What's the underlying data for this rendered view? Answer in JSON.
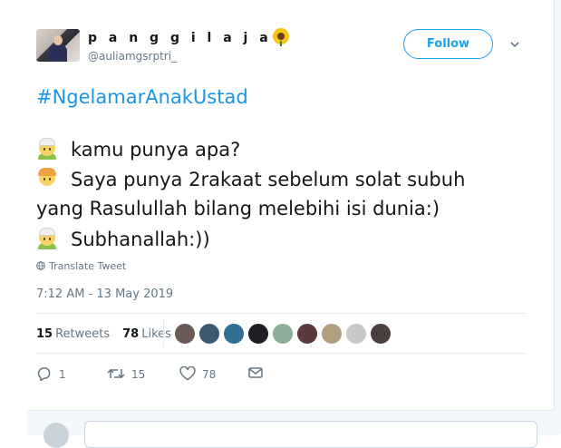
{
  "author": {
    "display_name": "p a n g g i l a j a",
    "display_emoji": "sunflower-emoji",
    "handle": "@auliamgsrptri_"
  },
  "follow_button": {
    "label": "Follow"
  },
  "tweet": {
    "hashtag": "#NgelamarAnakUstad",
    "lines": [
      "kamu punya apa?",
      "Saya punya 2rakaat sebelum solat subuh",
      "yang Rasulullah bilang melebihi isi dunia:)",
      "Subhanallah:))"
    ],
    "emojis": [
      "older-man-emoji",
      "person-blond-hair-emoji",
      "older-man-emoji"
    ]
  },
  "translate_label": "Translate Tweet",
  "timestamp": "7:12 AM - 13 May 2019",
  "stats": {
    "retweets_count": "15",
    "retweets_label": "Retweets",
    "likes_count": "78",
    "likes_label": "Likes"
  },
  "likers": [
    "#6b5a55",
    "#3d5a70",
    "#2f6f8f",
    "#1e1e24",
    "#8fae9a",
    "#5a3a3a",
    "#b0a080",
    "#c8c8c8",
    "#4a4040"
  ],
  "actions": {
    "reply_count": "1",
    "retweet_count": "15",
    "like_count": "78"
  },
  "colors": {
    "accent": "#1da1f2",
    "hashtag": "#1b95e0",
    "muted": "#657786",
    "text": "#14171a"
  }
}
